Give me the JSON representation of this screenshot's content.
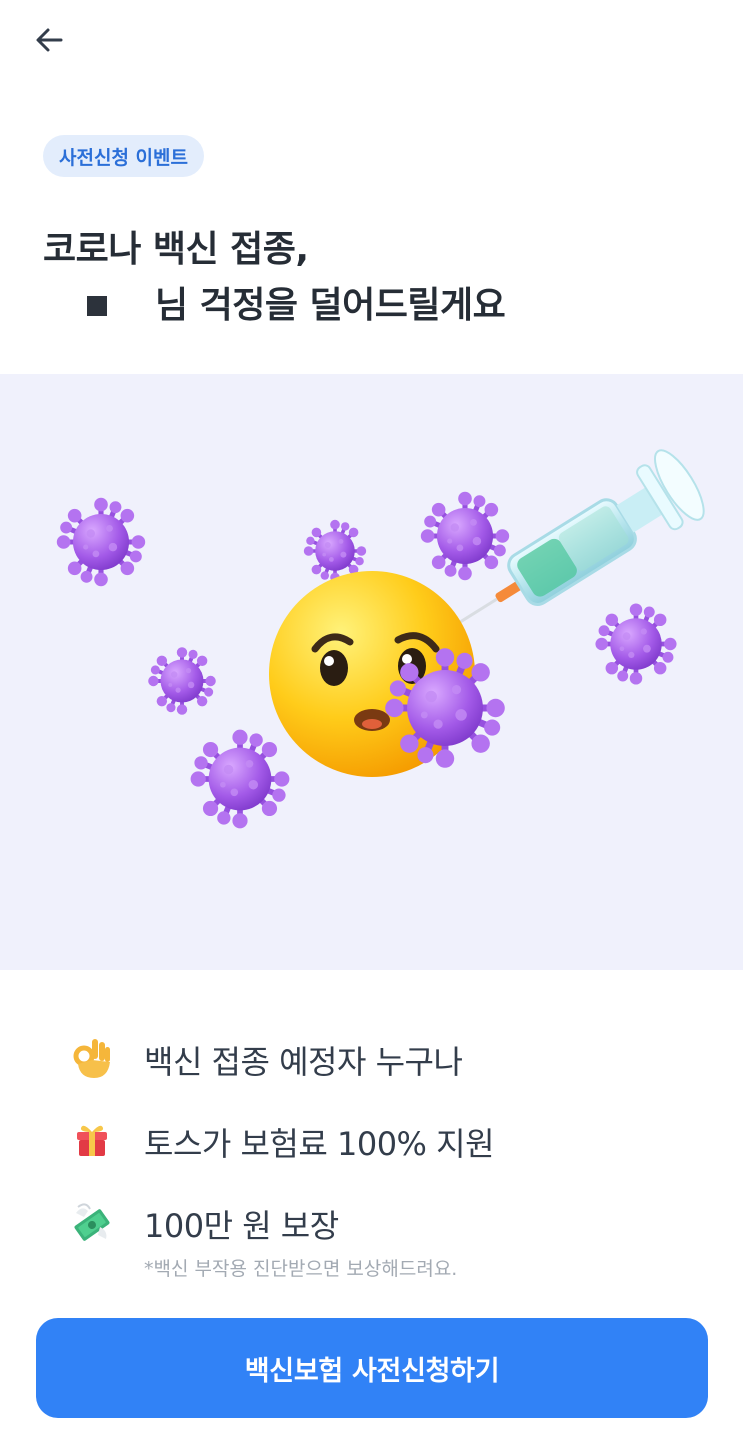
{
  "header": {
    "back_icon": "arrow-left-icon"
  },
  "badge": {
    "label": "사전신청 이벤트"
  },
  "title": {
    "line1": "코로나 백신 접종,",
    "line2": "님 걱정을 덜어드릴게요"
  },
  "hero": {
    "image": "vaccine-emoji-illustration",
    "colors": {
      "background": "#f0f1fc",
      "virus": "#a35ae8",
      "face": "#ffcc1a"
    }
  },
  "features": [
    {
      "icon": "ok-hand-icon",
      "text": "백신 접종 예정자 누구나"
    },
    {
      "icon": "gift-icon",
      "text": "토스가 보험료 100% 지원"
    },
    {
      "icon": "flying-money-icon",
      "text": "100만 원 보장",
      "note": "*백신 부작용 진단받으면 보상해드려요."
    }
  ],
  "cta": {
    "label": "백신보험 사전신청하기",
    "color": "#3182f6"
  }
}
